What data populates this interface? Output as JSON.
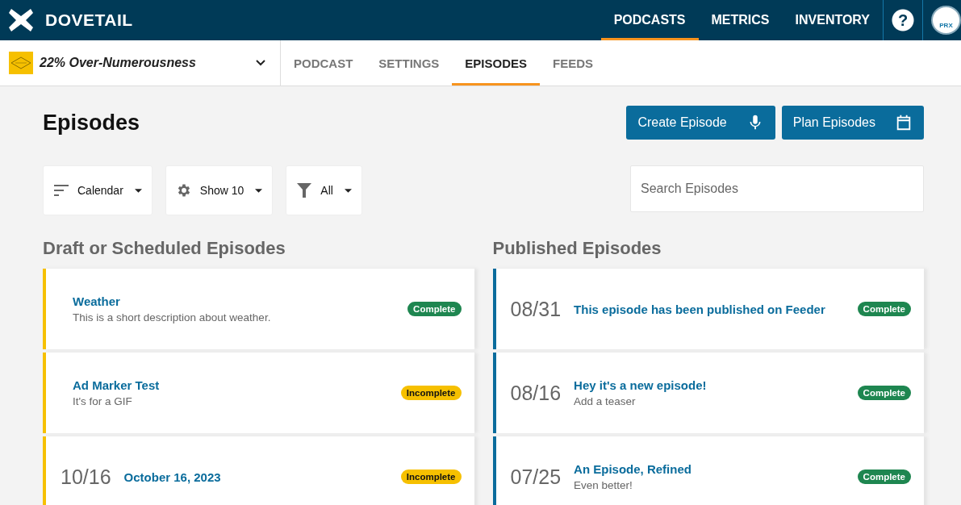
{
  "header": {
    "brand": "DOVETAIL",
    "nav": [
      {
        "label": "PODCASTS",
        "selected": true
      },
      {
        "label": "METRICS",
        "selected": false
      },
      {
        "label": "INVENTORY",
        "selected": false
      }
    ],
    "help": "?",
    "avatar": "PRX"
  },
  "podcast_bar": {
    "podcast": "22% Over-Numerousness",
    "tabs": [
      {
        "label": "PODCAST",
        "selected": false
      },
      {
        "label": "SETTINGS",
        "selected": false
      },
      {
        "label": "EPISODES",
        "selected": true
      },
      {
        "label": "FEEDS",
        "selected": false
      }
    ]
  },
  "page": {
    "title": "Episodes",
    "buttons": [
      {
        "label": "Create Episode",
        "kind": "mic"
      },
      {
        "label": "Plan Episodes",
        "kind": "calendar"
      }
    ],
    "filters": [
      {
        "label": "Calendar",
        "kind": "sort"
      },
      {
        "label": "Show 10",
        "kind": "gear"
      },
      {
        "label": "All",
        "kind": "filter"
      }
    ],
    "search": {
      "placeholder": "Search Episodes"
    }
  },
  "columns": [
    {
      "title": "Draft or Scheduled Episodes",
      "kind": "draft",
      "episodes": [
        {
          "title": "Weather",
          "teaser": "This is a short description about weather.",
          "status": "Complete",
          "kind": "complete"
        },
        {
          "title": "Ad Marker Test",
          "teaser": "It's for a GIF",
          "status": "Incomplete",
          "kind": "incomplete"
        },
        {
          "date": "10/16",
          "title": "October 16, 2023",
          "status": "Incomplete",
          "kind": "incomplete"
        }
      ]
    },
    {
      "title": "Published Episodes",
      "kind": "published",
      "episodes": [
        {
          "date": "08/31",
          "title": "This episode has been published on Feeder",
          "status": "Complete",
          "kind": "complete"
        },
        {
          "date": "08/16",
          "title": "Hey it's a new episode!",
          "teaser": "Add a teaser",
          "status": "Complete",
          "kind": "complete"
        },
        {
          "date": "07/25",
          "title": "An Episode, Refined",
          "teaser": "Even better!",
          "status": "Complete",
          "kind": "complete"
        }
      ]
    }
  ]
}
